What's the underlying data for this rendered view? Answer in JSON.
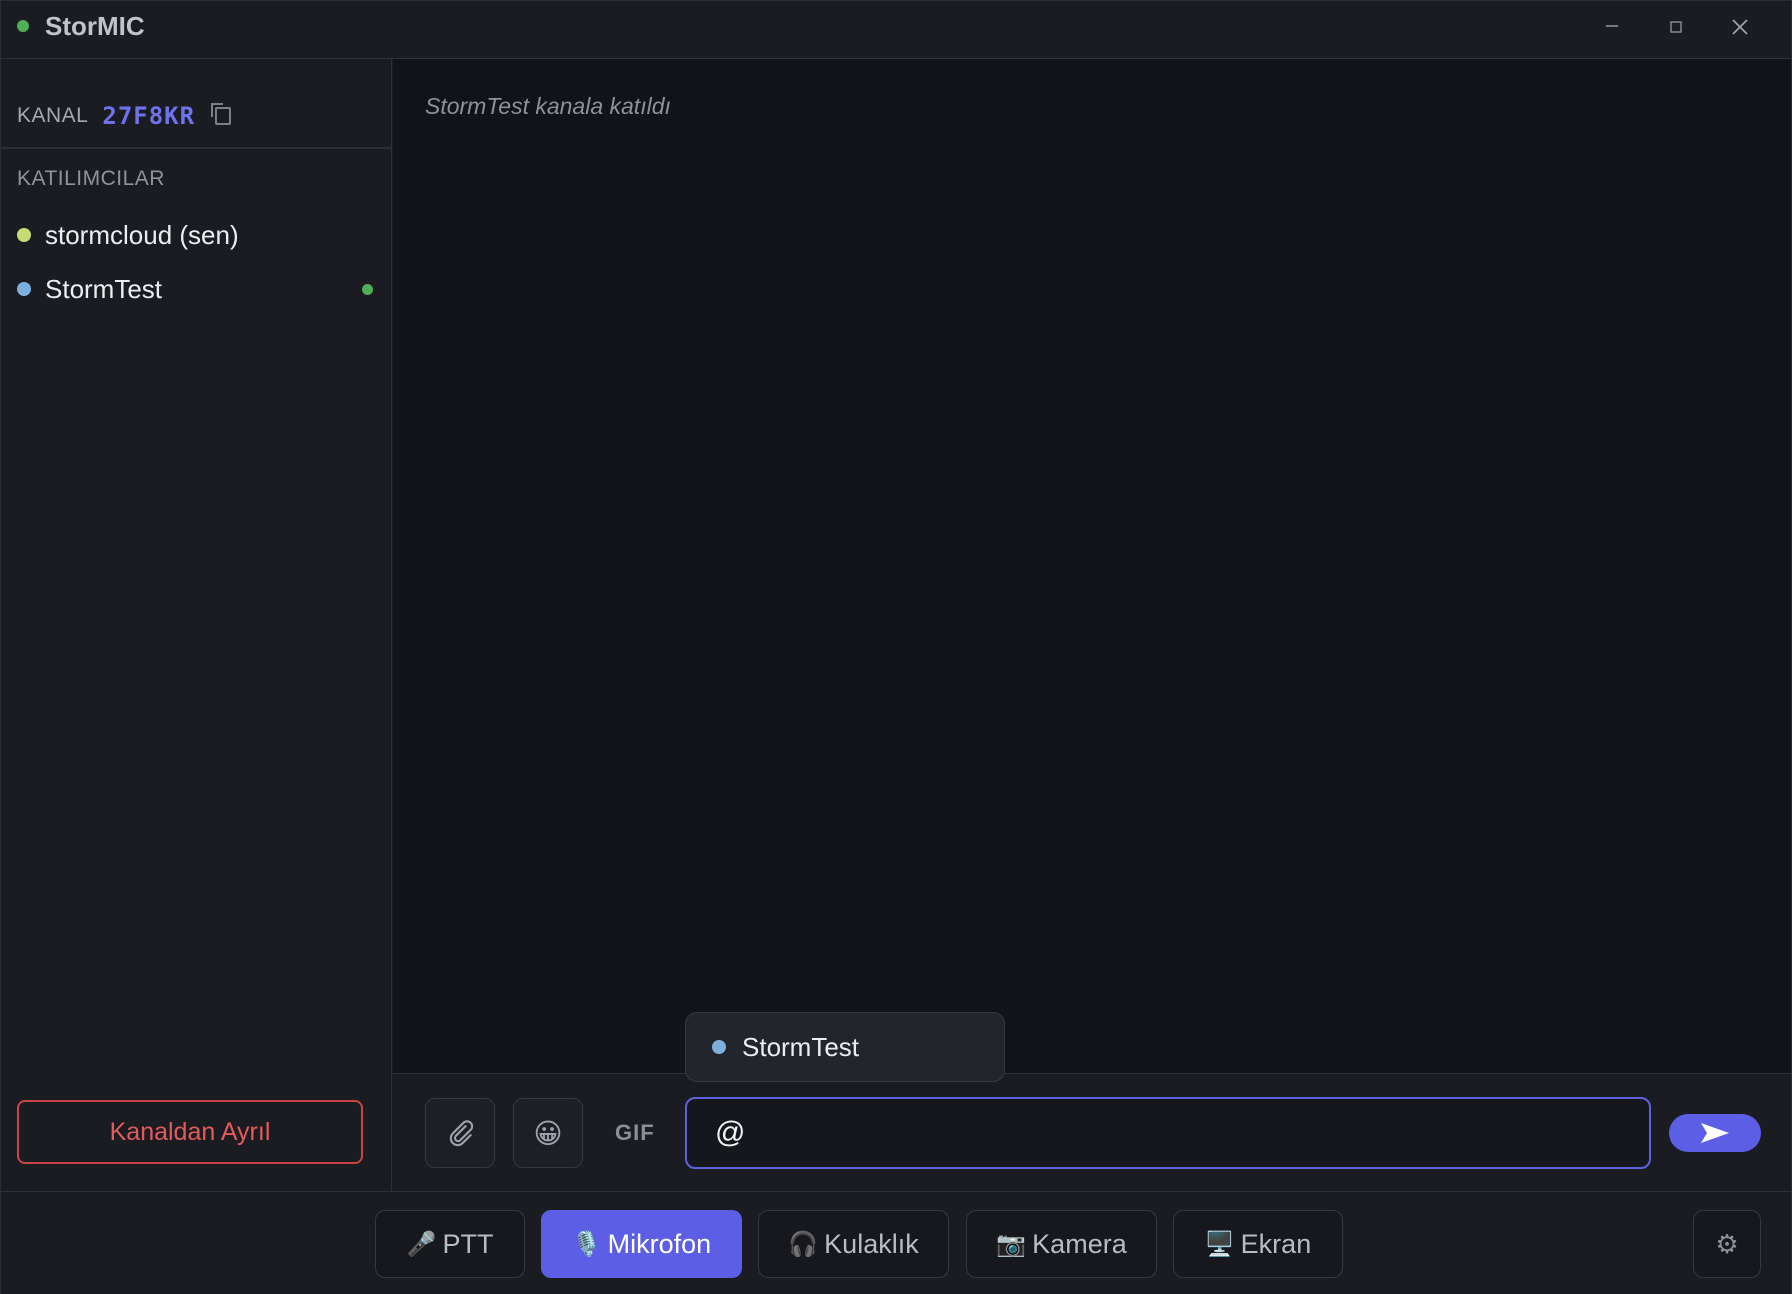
{
  "app": {
    "title": "StorMIC",
    "status_color": "#4fae58"
  },
  "titlebar": {
    "minimize_icon": "minimize-icon",
    "maximize_icon": "maximize-icon",
    "close_icon": "close-icon"
  },
  "sidebar": {
    "channel_label": "KANAL",
    "channel_code": "27F8KR",
    "participants_label": "KATILIMCILAR",
    "participants": [
      {
        "name": "stormcloud (sen)",
        "color": "#c5dc72",
        "speaking": false
      },
      {
        "name": "StormTest",
        "color": "#7eb0de",
        "speaking": true
      }
    ],
    "leave_label": "Kanaldan Ayrıl"
  },
  "chat": {
    "messages": [
      {
        "type": "system",
        "text": "StormTest kanala katıldı"
      }
    ]
  },
  "composer": {
    "attach_icon": "paperclip-icon",
    "emoji": "😀",
    "gif_label": "GIF",
    "input_value": "@",
    "send_icon": "send-icon"
  },
  "mention_popup": {
    "items": [
      {
        "name": "StormTest",
        "color": "#7eb0de"
      }
    ]
  },
  "controls": {
    "ptt": {
      "icon": "🎤",
      "label": "PTT"
    },
    "mic": {
      "icon": "🎙️",
      "label": "Mikrofon",
      "active": true
    },
    "headphones": {
      "icon": "🎧",
      "label": "Kulaklık"
    },
    "camera": {
      "icon": "📷",
      "label": "Kamera"
    },
    "screen": {
      "icon": "🖥️",
      "label": "Ekran"
    },
    "settings_icon": "⚙"
  },
  "colors": {
    "accent": "#5c5fe6",
    "danger": "#e45b5b",
    "online": "#4fae58"
  }
}
